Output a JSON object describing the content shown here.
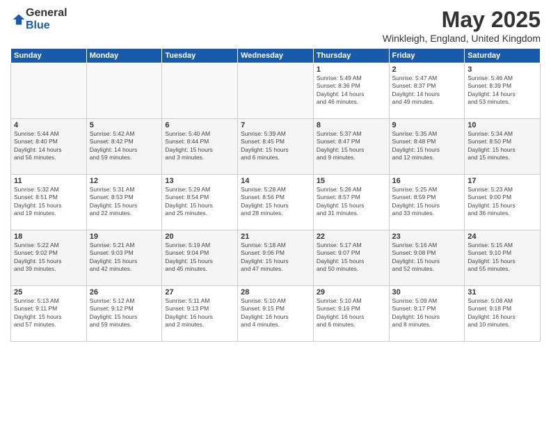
{
  "logo": {
    "general": "General",
    "blue": "Blue"
  },
  "title": "May 2025",
  "subtitle": "Winkleigh, England, United Kingdom",
  "headers": [
    "Sunday",
    "Monday",
    "Tuesday",
    "Wednesday",
    "Thursday",
    "Friday",
    "Saturday"
  ],
  "weeks": [
    [
      {
        "day": "",
        "info": ""
      },
      {
        "day": "",
        "info": ""
      },
      {
        "day": "",
        "info": ""
      },
      {
        "day": "",
        "info": ""
      },
      {
        "day": "1",
        "info": "Sunrise: 5:49 AM\nSunset: 8:36 PM\nDaylight: 14 hours\nand 46 minutes."
      },
      {
        "day": "2",
        "info": "Sunrise: 5:47 AM\nSunset: 8:37 PM\nDaylight: 14 hours\nand 49 minutes."
      },
      {
        "day": "3",
        "info": "Sunrise: 5:46 AM\nSunset: 8:39 PM\nDaylight: 14 hours\nand 53 minutes."
      }
    ],
    [
      {
        "day": "4",
        "info": "Sunrise: 5:44 AM\nSunset: 8:40 PM\nDaylight: 14 hours\nand 56 minutes."
      },
      {
        "day": "5",
        "info": "Sunrise: 5:42 AM\nSunset: 8:42 PM\nDaylight: 14 hours\nand 59 minutes."
      },
      {
        "day": "6",
        "info": "Sunrise: 5:40 AM\nSunset: 8:44 PM\nDaylight: 15 hours\nand 3 minutes."
      },
      {
        "day": "7",
        "info": "Sunrise: 5:39 AM\nSunset: 8:45 PM\nDaylight: 15 hours\nand 6 minutes."
      },
      {
        "day": "8",
        "info": "Sunrise: 5:37 AM\nSunset: 8:47 PM\nDaylight: 15 hours\nand 9 minutes."
      },
      {
        "day": "9",
        "info": "Sunrise: 5:35 AM\nSunset: 8:48 PM\nDaylight: 15 hours\nand 12 minutes."
      },
      {
        "day": "10",
        "info": "Sunrise: 5:34 AM\nSunset: 8:50 PM\nDaylight: 15 hours\nand 15 minutes."
      }
    ],
    [
      {
        "day": "11",
        "info": "Sunrise: 5:32 AM\nSunset: 8:51 PM\nDaylight: 15 hours\nand 19 minutes."
      },
      {
        "day": "12",
        "info": "Sunrise: 5:31 AM\nSunset: 8:53 PM\nDaylight: 15 hours\nand 22 minutes."
      },
      {
        "day": "13",
        "info": "Sunrise: 5:29 AM\nSunset: 8:54 PM\nDaylight: 15 hours\nand 25 minutes."
      },
      {
        "day": "14",
        "info": "Sunrise: 5:28 AM\nSunset: 8:56 PM\nDaylight: 15 hours\nand 28 minutes."
      },
      {
        "day": "15",
        "info": "Sunrise: 5:26 AM\nSunset: 8:57 PM\nDaylight: 15 hours\nand 31 minutes."
      },
      {
        "day": "16",
        "info": "Sunrise: 5:25 AM\nSunset: 8:59 PM\nDaylight: 15 hours\nand 33 minutes."
      },
      {
        "day": "17",
        "info": "Sunrise: 5:23 AM\nSunset: 9:00 PM\nDaylight: 15 hours\nand 36 minutes."
      }
    ],
    [
      {
        "day": "18",
        "info": "Sunrise: 5:22 AM\nSunset: 9:02 PM\nDaylight: 15 hours\nand 39 minutes."
      },
      {
        "day": "19",
        "info": "Sunrise: 5:21 AM\nSunset: 9:03 PM\nDaylight: 15 hours\nand 42 minutes."
      },
      {
        "day": "20",
        "info": "Sunrise: 5:19 AM\nSunset: 9:04 PM\nDaylight: 15 hours\nand 45 minutes."
      },
      {
        "day": "21",
        "info": "Sunrise: 5:18 AM\nSunset: 9:06 PM\nDaylight: 15 hours\nand 47 minutes."
      },
      {
        "day": "22",
        "info": "Sunrise: 5:17 AM\nSunset: 9:07 PM\nDaylight: 15 hours\nand 50 minutes."
      },
      {
        "day": "23",
        "info": "Sunrise: 5:16 AM\nSunset: 9:08 PM\nDaylight: 15 hours\nand 52 minutes."
      },
      {
        "day": "24",
        "info": "Sunrise: 5:15 AM\nSunset: 9:10 PM\nDaylight: 15 hours\nand 55 minutes."
      }
    ],
    [
      {
        "day": "25",
        "info": "Sunrise: 5:13 AM\nSunset: 9:11 PM\nDaylight: 15 hours\nand 57 minutes."
      },
      {
        "day": "26",
        "info": "Sunrise: 5:12 AM\nSunset: 9:12 PM\nDaylight: 15 hours\nand 59 minutes."
      },
      {
        "day": "27",
        "info": "Sunrise: 5:11 AM\nSunset: 9:13 PM\nDaylight: 16 hours\nand 2 minutes."
      },
      {
        "day": "28",
        "info": "Sunrise: 5:10 AM\nSunset: 9:15 PM\nDaylight: 16 hours\nand 4 minutes."
      },
      {
        "day": "29",
        "info": "Sunrise: 5:10 AM\nSunset: 9:16 PM\nDaylight: 16 hours\nand 6 minutes."
      },
      {
        "day": "30",
        "info": "Sunrise: 5:09 AM\nSunset: 9:17 PM\nDaylight: 16 hours\nand 8 minutes."
      },
      {
        "day": "31",
        "info": "Sunrise: 5:08 AM\nSunset: 9:18 PM\nDaylight: 16 hours\nand 10 minutes."
      }
    ]
  ]
}
